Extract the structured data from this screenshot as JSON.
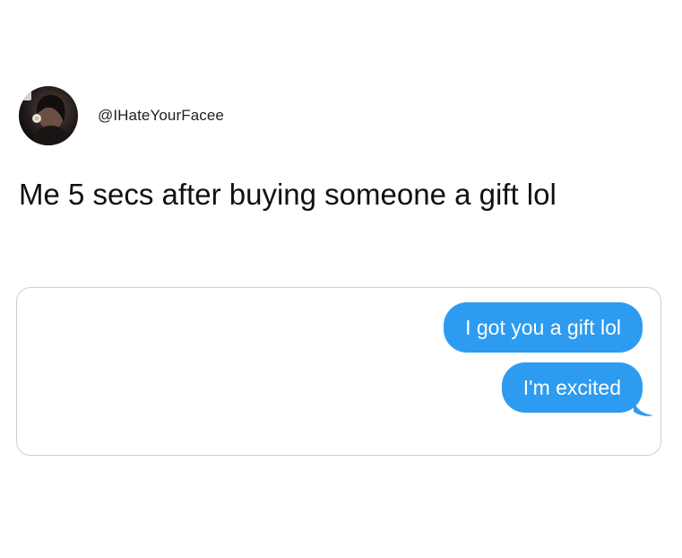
{
  "post": {
    "username": "@IHateYourFacee",
    "caption": "Me 5 secs after buying someone a gift lol"
  },
  "chat": {
    "messages": [
      {
        "text": "I got you a gift lol",
        "from": "me"
      },
      {
        "text": "I'm excited",
        "from": "me"
      }
    ],
    "bubble_color": "#2d9bf0",
    "bubble_text_color": "#ffffff"
  },
  "icons": {
    "avatar": "profile-photo"
  }
}
